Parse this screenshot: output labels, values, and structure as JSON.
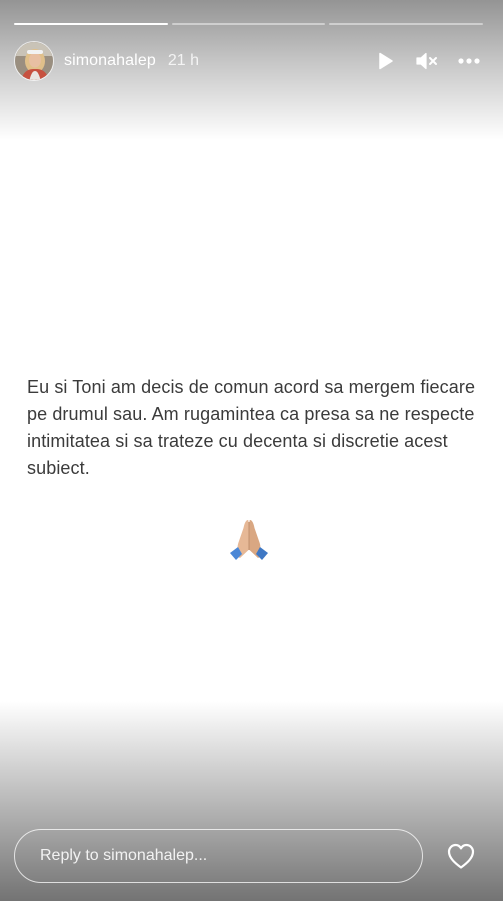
{
  "story": {
    "progress": [
      {
        "fill": 1.0
      },
      {
        "fill": 0.0
      },
      {
        "fill": 0.0
      }
    ],
    "user": {
      "username": "simonahalep",
      "timestamp": "21 h",
      "avatar_icon": "profile-avatar"
    },
    "controls": {
      "play_icon": "play-icon",
      "mute_icon": "muted-speaker-icon",
      "more_icon": "more-options-icon"
    },
    "content": {
      "message": "Eu si Toni am decis de comun acord sa mergem fiecare pe drumul sau. Am rugamintea ca presa sa ne respecte intimitatea si sa trateze cu decenta si discretie acest subiect.",
      "emoji": "folded-hands-emoji"
    },
    "reply": {
      "placeholder": "Reply to simonahalep...",
      "value": "",
      "like_icon": "heart-icon"
    }
  }
}
